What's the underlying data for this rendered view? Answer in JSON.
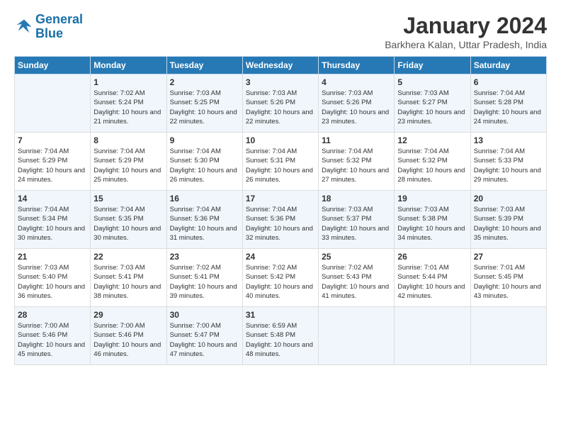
{
  "header": {
    "logo_line1": "General",
    "logo_line2": "Blue",
    "main_title": "January 2024",
    "subtitle": "Barkhera Kalan, Uttar Pradesh, India"
  },
  "columns": [
    "Sunday",
    "Monday",
    "Tuesday",
    "Wednesday",
    "Thursday",
    "Friday",
    "Saturday"
  ],
  "weeks": [
    [
      {
        "day": "",
        "sunrise": "",
        "sunset": "",
        "daylight": ""
      },
      {
        "day": "1",
        "sunrise": "7:02 AM",
        "sunset": "5:24 PM",
        "daylight": "10 hours and 21 minutes."
      },
      {
        "day": "2",
        "sunrise": "7:03 AM",
        "sunset": "5:25 PM",
        "daylight": "10 hours and 22 minutes."
      },
      {
        "day": "3",
        "sunrise": "7:03 AM",
        "sunset": "5:26 PM",
        "daylight": "10 hours and 22 minutes."
      },
      {
        "day": "4",
        "sunrise": "7:03 AM",
        "sunset": "5:26 PM",
        "daylight": "10 hours and 23 minutes."
      },
      {
        "day": "5",
        "sunrise": "7:03 AM",
        "sunset": "5:27 PM",
        "daylight": "10 hours and 23 minutes."
      },
      {
        "day": "6",
        "sunrise": "7:04 AM",
        "sunset": "5:28 PM",
        "daylight": "10 hours and 24 minutes."
      }
    ],
    [
      {
        "day": "7",
        "sunrise": "7:04 AM",
        "sunset": "5:29 PM",
        "daylight": "10 hours and 24 minutes."
      },
      {
        "day": "8",
        "sunrise": "7:04 AM",
        "sunset": "5:29 PM",
        "daylight": "10 hours and 25 minutes."
      },
      {
        "day": "9",
        "sunrise": "7:04 AM",
        "sunset": "5:30 PM",
        "daylight": "10 hours and 26 minutes."
      },
      {
        "day": "10",
        "sunrise": "7:04 AM",
        "sunset": "5:31 PM",
        "daylight": "10 hours and 26 minutes."
      },
      {
        "day": "11",
        "sunrise": "7:04 AM",
        "sunset": "5:32 PM",
        "daylight": "10 hours and 27 minutes."
      },
      {
        "day": "12",
        "sunrise": "7:04 AM",
        "sunset": "5:32 PM",
        "daylight": "10 hours and 28 minutes."
      },
      {
        "day": "13",
        "sunrise": "7:04 AM",
        "sunset": "5:33 PM",
        "daylight": "10 hours and 29 minutes."
      }
    ],
    [
      {
        "day": "14",
        "sunrise": "7:04 AM",
        "sunset": "5:34 PM",
        "daylight": "10 hours and 30 minutes."
      },
      {
        "day": "15",
        "sunrise": "7:04 AM",
        "sunset": "5:35 PM",
        "daylight": "10 hours and 30 minutes."
      },
      {
        "day": "16",
        "sunrise": "7:04 AM",
        "sunset": "5:36 PM",
        "daylight": "10 hours and 31 minutes."
      },
      {
        "day": "17",
        "sunrise": "7:04 AM",
        "sunset": "5:36 PM",
        "daylight": "10 hours and 32 minutes."
      },
      {
        "day": "18",
        "sunrise": "7:03 AM",
        "sunset": "5:37 PM",
        "daylight": "10 hours and 33 minutes."
      },
      {
        "day": "19",
        "sunrise": "7:03 AM",
        "sunset": "5:38 PM",
        "daylight": "10 hours and 34 minutes."
      },
      {
        "day": "20",
        "sunrise": "7:03 AM",
        "sunset": "5:39 PM",
        "daylight": "10 hours and 35 minutes."
      }
    ],
    [
      {
        "day": "21",
        "sunrise": "7:03 AM",
        "sunset": "5:40 PM",
        "daylight": "10 hours and 36 minutes."
      },
      {
        "day": "22",
        "sunrise": "7:03 AM",
        "sunset": "5:41 PM",
        "daylight": "10 hours and 38 minutes."
      },
      {
        "day": "23",
        "sunrise": "7:02 AM",
        "sunset": "5:41 PM",
        "daylight": "10 hours and 39 minutes."
      },
      {
        "day": "24",
        "sunrise": "7:02 AM",
        "sunset": "5:42 PM",
        "daylight": "10 hours and 40 minutes."
      },
      {
        "day": "25",
        "sunrise": "7:02 AM",
        "sunset": "5:43 PM",
        "daylight": "10 hours and 41 minutes."
      },
      {
        "day": "26",
        "sunrise": "7:01 AM",
        "sunset": "5:44 PM",
        "daylight": "10 hours and 42 minutes."
      },
      {
        "day": "27",
        "sunrise": "7:01 AM",
        "sunset": "5:45 PM",
        "daylight": "10 hours and 43 minutes."
      }
    ],
    [
      {
        "day": "28",
        "sunrise": "7:00 AM",
        "sunset": "5:46 PM",
        "daylight": "10 hours and 45 minutes."
      },
      {
        "day": "29",
        "sunrise": "7:00 AM",
        "sunset": "5:46 PM",
        "daylight": "10 hours and 46 minutes."
      },
      {
        "day": "30",
        "sunrise": "7:00 AM",
        "sunset": "5:47 PM",
        "daylight": "10 hours and 47 minutes."
      },
      {
        "day": "31",
        "sunrise": "6:59 AM",
        "sunset": "5:48 PM",
        "daylight": "10 hours and 48 minutes."
      },
      {
        "day": "",
        "sunrise": "",
        "sunset": "",
        "daylight": ""
      },
      {
        "day": "",
        "sunrise": "",
        "sunset": "",
        "daylight": ""
      },
      {
        "day": "",
        "sunrise": "",
        "sunset": "",
        "daylight": ""
      }
    ]
  ]
}
